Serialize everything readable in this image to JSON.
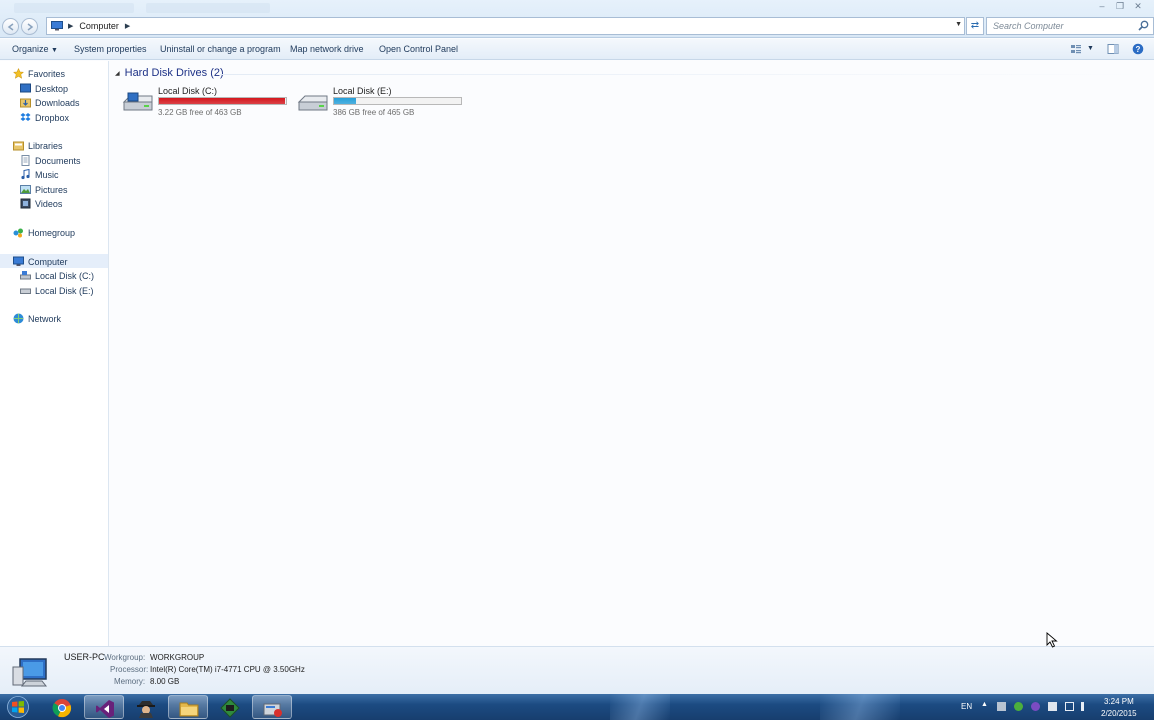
{
  "window": {
    "address": {
      "crumb": "Computer"
    },
    "search_placeholder": "Search Computer"
  },
  "toolbar": {
    "organize": "Organize",
    "system_properties": "System properties",
    "uninstall": "Uninstall or change a program",
    "map_drive": "Map network drive",
    "control_panel": "Open Control Panel"
  },
  "nav": {
    "favorites": "Favorites",
    "desktop": "Desktop",
    "downloads": "Downloads",
    "dropbox": "Dropbox",
    "libraries": "Libraries",
    "documents": "Documents",
    "music": "Music",
    "pictures": "Pictures",
    "videos": "Videos",
    "homegroup": "Homegroup",
    "computer": "Computer",
    "disk_c": "Local Disk (C:)",
    "disk_e": "Local Disk (E:)",
    "network": "Network"
  },
  "content": {
    "group_title": "Hard Disk Drives (2)",
    "drives": [
      {
        "name": "Local Disk (C:)",
        "free_text": "3.22 GB free of 463 GB",
        "used_fraction": 0.993,
        "bar_color": "#d4161d"
      },
      {
        "name": "Local Disk (E:)",
        "free_text": "386 GB free of 465 GB",
        "used_fraction": 0.17,
        "bar_color": "#26a0da"
      }
    ]
  },
  "details": {
    "pc_name": "USER-PC",
    "workgroup_label": "Workgroup:",
    "workgroup": "WORKGROUP",
    "processor_label": "Processor:",
    "processor": "Intel(R) Core(TM) i7-4771 CPU @ 3.50GHz",
    "memory_label": "Memory:",
    "memory": "8.00 GB"
  },
  "taskbar": {
    "lang": "EN",
    "time": "3:24 PM",
    "date": "2/20/2015"
  }
}
